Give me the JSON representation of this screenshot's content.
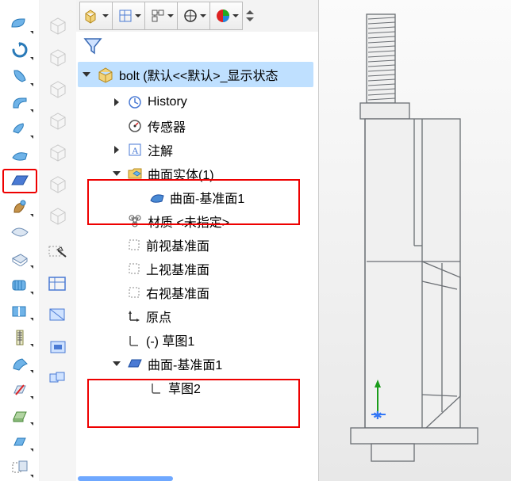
{
  "tree": {
    "root": "bolt (默认<<默认>_显示状态",
    "history": "History",
    "sensors": "传感器",
    "annotations": "注解",
    "surface_bodies": "曲面实体(1)",
    "surface_plane1_a": "曲面-基准面1",
    "material": "材质 <未指定>",
    "front_plane": "前视基准面",
    "top_plane": "上视基准面",
    "right_plane": "右视基准面",
    "origin": "原点",
    "sketch1": "(-) 草图1",
    "surface_plane1_b": "曲面-基准面1",
    "sketch2": "草图2"
  },
  "colors": {
    "line": "#6a6e73",
    "blue": "#3478f6",
    "green": "#1a9c1a"
  }
}
